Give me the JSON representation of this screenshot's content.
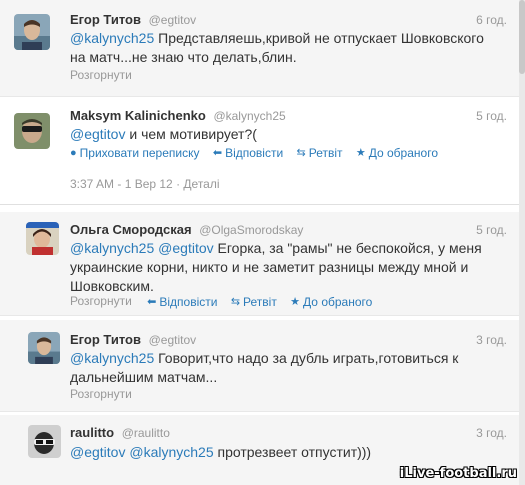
{
  "tweets": [
    {
      "name": "Егор Титов",
      "handle": "@egtitov",
      "time": "6 год.",
      "mention1": "@kalynych25",
      "text": " Представляешь,кривой не отпускает Шовковского на матч...не знаю что делать,блин.",
      "expand": "Розгорнути"
    },
    {
      "name": "Maksym Kalinichenko",
      "handle": "@kalynych25",
      "time": "5 год.",
      "mention1": "@egtitov",
      "text": " и чем мотивирует?(",
      "hide_conv": "Приховати переписку",
      "reply": "Відповісти",
      "retweet": "Ретвіт",
      "favorite": "До обраного",
      "timestamp": "3:37 AM - 1 Вер 12",
      "details": "Деталі"
    },
    {
      "name": "Ольга Смородская",
      "handle": "@OlgaSmorodskay",
      "time": "5 год.",
      "mention1": "@kalynych25",
      "mention2": "@egtitov",
      "text": " Егорка, за \"рамы\" не беспокойся, у меня украинские корни, никто и не заметит разницы между мной и Шовковским.",
      "expand": "Розгорнути",
      "reply": "Відповісти",
      "retweet": "Ретвіт",
      "favorite": "До обраного"
    },
    {
      "name": "Егор Титов",
      "handle": "@egtitov",
      "time": "3 год.",
      "mention1": "@kalynych25",
      "text": " Говорит,что надо за дубль играть,готовиться к дальнейшим матчам...",
      "expand": "Розгорнути"
    },
    {
      "name": "raulitto",
      "handle": "@raulitto",
      "time": "3 год.",
      "mention1": "@egtitov",
      "mention2": "@kalynych25",
      "text": " протрезвеет отпустит)))"
    }
  ],
  "icons": {
    "reply": "reply-arrow-icon",
    "retweet": "retweet-icon",
    "favorite": "star-icon",
    "conversation": "conversation-icon"
  },
  "colors": {
    "link": "#2b7bb9",
    "muted": "#999999"
  },
  "watermark": "iLive-football.ru"
}
